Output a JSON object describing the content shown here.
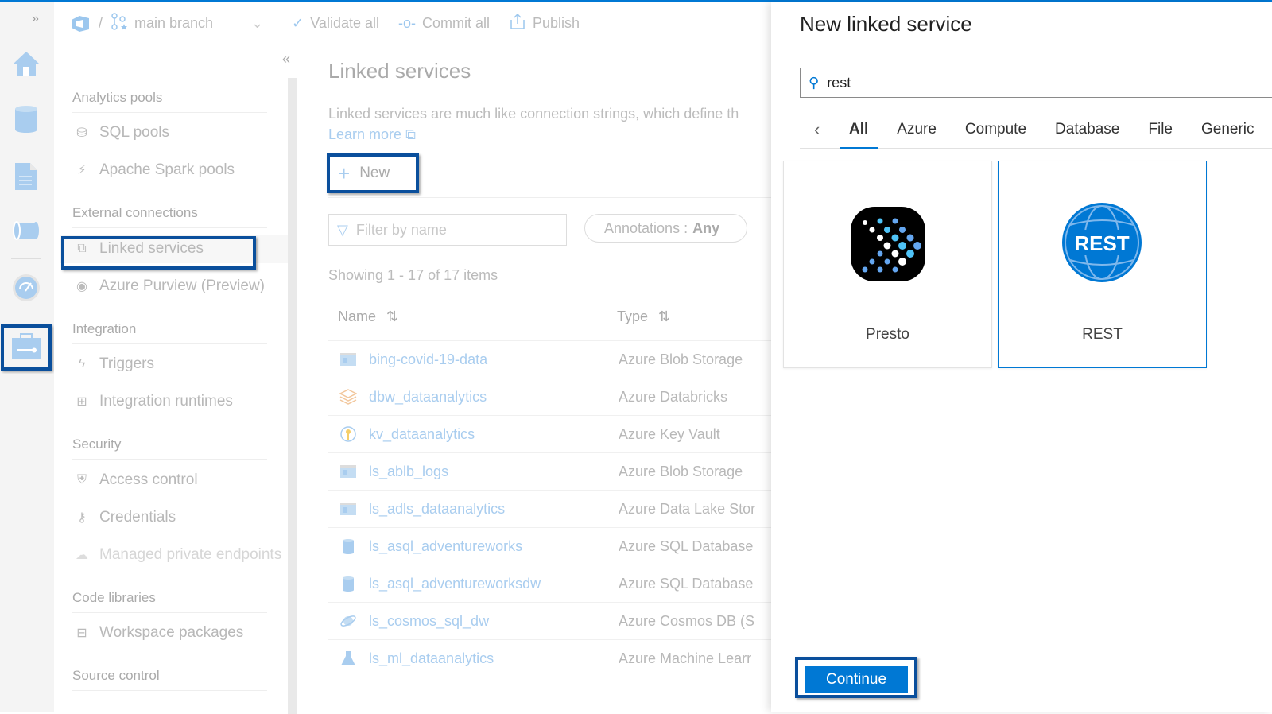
{
  "toolbar": {
    "branch": "main branch",
    "validate_all": "Validate all",
    "commit_all": "Commit all",
    "publish": "Publish"
  },
  "rail": {
    "items": [
      {
        "icon": "home-icon"
      },
      {
        "icon": "data-icon"
      },
      {
        "icon": "develop-icon"
      },
      {
        "icon": "integrate-icon"
      },
      {
        "icon": "monitor-icon"
      },
      {
        "icon": "manage-icon",
        "active": true
      }
    ]
  },
  "nav": {
    "sections": [
      {
        "title": "Analytics pools",
        "items": [
          "SQL pools",
          "Apache Spark pools"
        ]
      },
      {
        "title": "External connections",
        "items": [
          "Linked services",
          "Azure Purview (Preview)"
        ]
      },
      {
        "title": "Integration",
        "items": [
          "Triggers",
          "Integration runtimes"
        ]
      },
      {
        "title": "Security",
        "items": [
          "Access control",
          "Credentials",
          "Managed private endpoints"
        ]
      },
      {
        "title": "Code libraries",
        "items": [
          "Workspace packages"
        ]
      },
      {
        "title": "Source control",
        "items": []
      }
    ],
    "selected": "Linked services"
  },
  "main": {
    "title": "Linked services",
    "description": "Linked services are much like connection strings, which define th",
    "learn_more": "Learn more",
    "new_label": "New",
    "filter_placeholder": "Filter by name",
    "annotations_label": "Annotations :",
    "annotations_value": "Any",
    "showing": "Showing 1 - 17 of 17 items",
    "columns": [
      "Name",
      "Type"
    ],
    "rows": [
      {
        "name": "bing-covid-19-data",
        "type": "Azure Blob Storage",
        "icon": "blob-storage-icon"
      },
      {
        "name": "dbw_dataanalytics",
        "type": "Azure Databricks",
        "icon": "databricks-icon"
      },
      {
        "name": "kv_dataanalytics",
        "type": "Azure Key Vault",
        "icon": "key-vault-icon"
      },
      {
        "name": "ls_ablb_logs",
        "type": "Azure Blob Storage",
        "icon": "blob-storage-icon"
      },
      {
        "name": "ls_adls_dataanalytics",
        "type": "Azure Data Lake Stor",
        "icon": "data-lake-icon"
      },
      {
        "name": "ls_asql_adventureworks",
        "type": "Azure SQL Database",
        "icon": "sql-database-icon"
      },
      {
        "name": "ls_asql_adventureworksdw",
        "type": "Azure SQL Database",
        "icon": "sql-database-icon"
      },
      {
        "name": "ls_cosmos_sql_dw",
        "type": "Azure Cosmos DB (S",
        "icon": "cosmos-db-icon"
      },
      {
        "name": "ls_ml_dataanalytics",
        "type": "Azure Machine Learr",
        "icon": "machine-learning-icon"
      }
    ]
  },
  "panel": {
    "title": "New linked service",
    "search_value": "rest",
    "tabs": [
      "All",
      "Azure",
      "Compute",
      "Database",
      "File",
      "Generic"
    ],
    "active_tab": "All",
    "cards": [
      {
        "label": "Presto",
        "icon": "presto-logo-icon",
        "selected": false
      },
      {
        "label": "REST",
        "icon": "rest-logo-icon",
        "selected": true
      }
    ],
    "rest_logo_text": "REST",
    "continue_label": "Continue"
  },
  "colors": {
    "accent": "#0078d4",
    "highlight_box": "#0a4f9c"
  }
}
